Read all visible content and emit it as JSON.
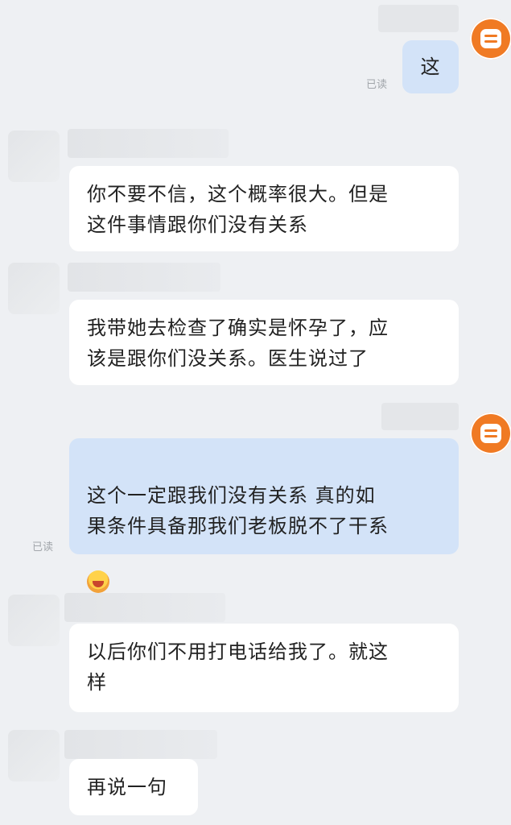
{
  "messages": [
    {
      "side": "out",
      "text": "这",
      "status": "已读"
    },
    {
      "side": "in",
      "text": "你不要不信，这个概率很大。但是\n这件事情跟你们没有关系"
    },
    {
      "side": "in",
      "text": "我带她去检查了确实是怀孕了，应\n该是跟你们没关系。医生说过了"
    },
    {
      "side": "out",
      "text": "这个一定跟我们没有关系 真的如\n果条件具备那我们老板脱不了干系",
      "status": "已读",
      "emoji": "laughing-face-emoji"
    },
    {
      "side": "in",
      "text": "以后你们不用打电话给我了。就这\n样"
    },
    {
      "side": "in",
      "text": "再说一句"
    }
  ],
  "colors": {
    "background": "#eef0f3",
    "incoming_bubble": "#ffffff",
    "outgoing_bubble": "#d3e3f8",
    "avatar_accent": "#f07a23"
  }
}
